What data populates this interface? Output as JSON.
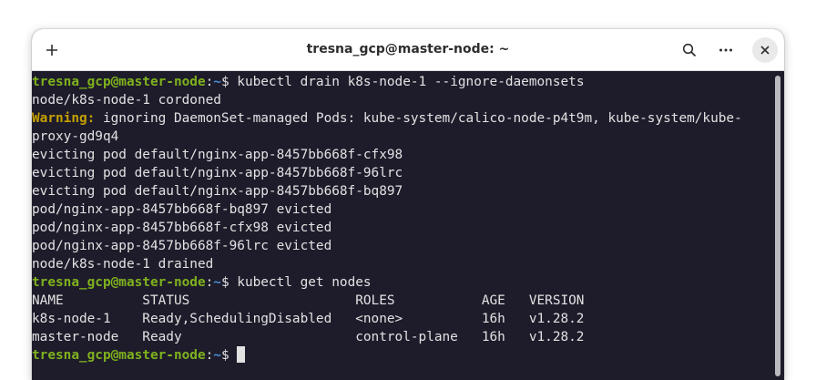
{
  "window": {
    "title": "tresna_gcp@master-node: ~"
  },
  "icons": {
    "new_tab": "plus-icon",
    "search": "search-icon",
    "menu": "more-horizontal-icon",
    "close": "close-icon"
  },
  "colors": {
    "terminal_bg": "#1e1c2b",
    "prompt_user": "#7fb21d",
    "prompt_path": "#4a8fd8",
    "warning": "#c4a000",
    "text": "#e2e2e2"
  },
  "prompt": {
    "user_host": "tresna_gcp@master-node",
    "colon": ":",
    "path": "~",
    "symbol": "$ "
  },
  "terminal": {
    "cmd1": "kubectl drain k8s-node-1 --ignore-daemonsets",
    "out1": "node/k8s-node-1 cordoned",
    "warn_label": "Warning:",
    "warn_text": " ignoring DaemonSet-managed Pods: kube-system/calico-node-p4t9m, kube-system/kube-",
    "warn_cont": "proxy-gd9q4",
    "evict1": "evicting pod default/nginx-app-8457bb668f-cfx98",
    "evict2": "evicting pod default/nginx-app-8457bb668f-96lrc",
    "evict3": "evicting pod default/nginx-app-8457bb668f-bq897",
    "evicted1": "pod/nginx-app-8457bb668f-bq897 evicted",
    "evicted2": "pod/nginx-app-8457bb668f-cfx98 evicted",
    "evicted3": "pod/nginx-app-8457bb668f-96lrc evicted",
    "drained": "node/k8s-node-1 drained",
    "cmd2": "kubectl get nodes",
    "table_header": "NAME          STATUS                     ROLES           AGE   VERSION",
    "row1": "k8s-node-1    Ready,SchedulingDisabled   <none>          16h   v1.28.2",
    "row2": "master-node   Ready                      control-plane   16h   v1.28.2"
  }
}
